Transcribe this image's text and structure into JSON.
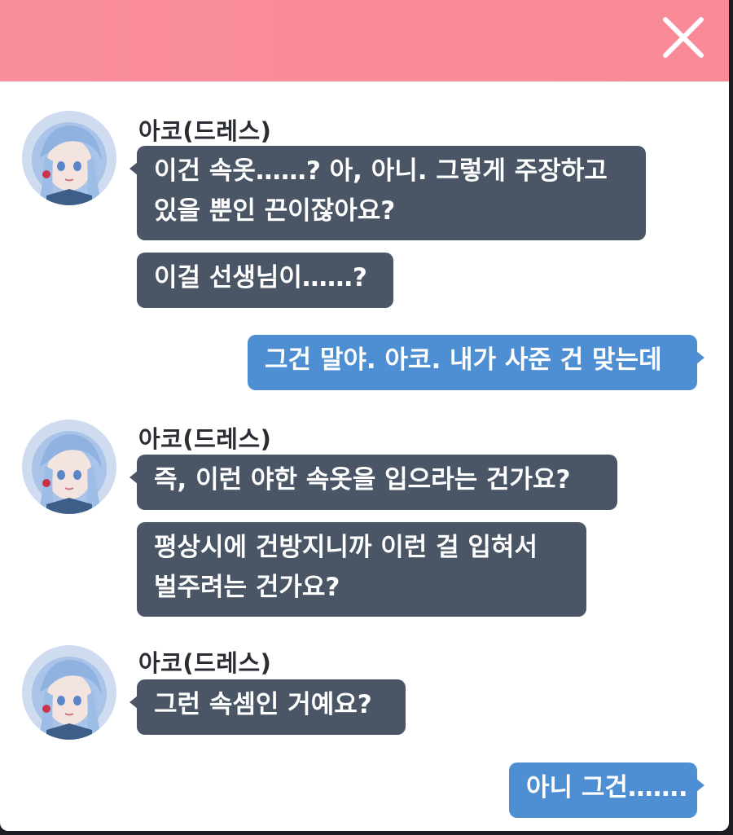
{
  "header": {
    "close_icon": "close-icon",
    "accent_color": "#fb8e9c"
  },
  "messages": [
    {
      "speaker": "아코(드레스)",
      "bubbles": [
        "이건 속옷……? 아, 아니. 그렇게 주장하고\n있을 뿐인 끈이잖아요?",
        "이걸 선생님이……?"
      ]
    },
    {
      "speaker": "player",
      "bubbles": [
        "그건 말야. 아코. 내가 사준 건 맞는데"
      ]
    },
    {
      "speaker": "아코(드레스)",
      "bubbles": [
        "즉, 이런 야한 속옷을 입으라는 건가요?",
        "평상시에 건방지니까 이런 걸 입혀서\n벌주려는 건가요?"
      ]
    },
    {
      "speaker": "아코(드레스)",
      "bubbles": [
        "그런 속셈인 거예요?"
      ]
    },
    {
      "speaker": "player",
      "bubbles": [
        "아니 그건……."
      ]
    }
  ],
  "colors": {
    "npc_bubble": "#4a5566",
    "player_bubble": "#4d8fd2",
    "background": "#ffffff"
  }
}
